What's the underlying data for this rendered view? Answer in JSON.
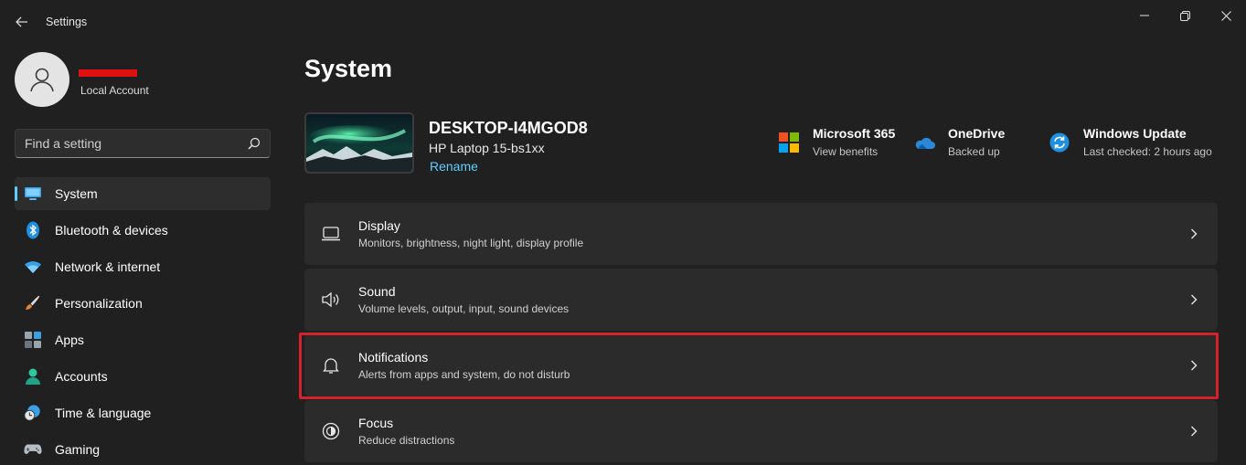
{
  "window": {
    "title": "Settings"
  },
  "profile": {
    "account_type": "Local Account"
  },
  "search": {
    "placeholder": "Find a setting"
  },
  "sidebar": {
    "items": [
      {
        "label": "System",
        "icon": "system-display-icon",
        "active": true
      },
      {
        "label": "Bluetooth & devices",
        "icon": "bluetooth-icon"
      },
      {
        "label": "Network & internet",
        "icon": "wifi-icon"
      },
      {
        "label": "Personalization",
        "icon": "paintbrush-icon"
      },
      {
        "label": "Apps",
        "icon": "apps-icon"
      },
      {
        "label": "Accounts",
        "icon": "accounts-icon"
      },
      {
        "label": "Time & language",
        "icon": "globe-clock-icon"
      },
      {
        "label": "Gaming",
        "icon": "gamepad-icon"
      }
    ]
  },
  "main": {
    "title": "System",
    "device": {
      "name": "DESKTOP-I4MGOD8",
      "model": "HP Laptop 15-bs1xx",
      "rename_label": "Rename"
    },
    "quick_info": [
      {
        "title": "Microsoft 365",
        "subtitle": "View benefits",
        "icon": "microsoft-logo-icon"
      },
      {
        "title": "OneDrive",
        "subtitle": "Backed up",
        "icon": "onedrive-cloud-icon"
      },
      {
        "title": "Windows Update",
        "subtitle": "Last checked: 2 hours ago",
        "icon": "windows-update-icon"
      }
    ],
    "cards": [
      {
        "title": "Display",
        "subtitle": "Monitors, brightness, night light, display profile",
        "icon": "laptop-icon"
      },
      {
        "title": "Sound",
        "subtitle": "Volume levels, output, input, sound devices",
        "icon": "speaker-icon"
      },
      {
        "title": "Notifications",
        "subtitle": "Alerts from apps and system, do not disturb",
        "icon": "bell-icon",
        "highlighted": true
      },
      {
        "title": "Focus",
        "subtitle": "Reduce distractions",
        "icon": "focus-icon"
      }
    ]
  },
  "colors": {
    "background": "#202020",
    "card": "#2b2b2b",
    "accent": "#60cdff",
    "highlight_border": "#d6202a"
  }
}
